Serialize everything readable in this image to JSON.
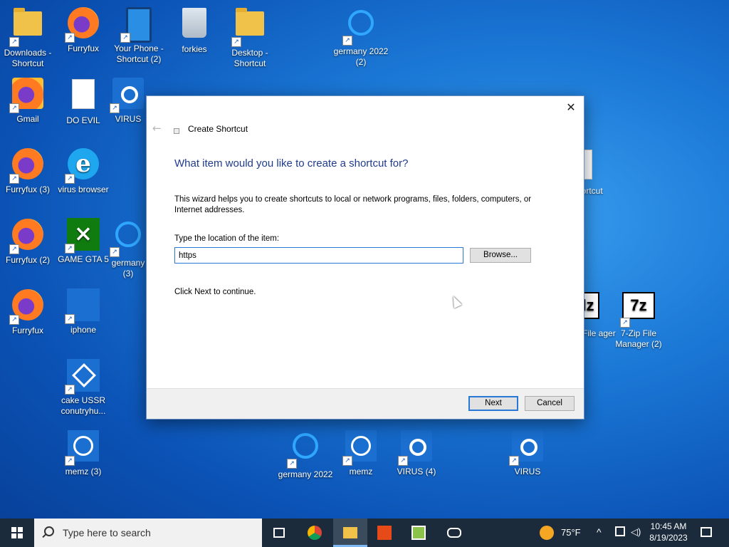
{
  "desktop": {
    "icons": [
      {
        "label": "Downloads - Shortcut",
        "icon": "folder-icon"
      },
      {
        "label": "Furryfux",
        "icon": "firefox-icon"
      },
      {
        "label": "Your Phone - Shortcut (2)",
        "icon": "phone-icon"
      },
      {
        "label": "forkies",
        "icon": "recycle-bin-icon"
      },
      {
        "label": "Desktop - Shortcut",
        "icon": "folder-icon"
      },
      {
        "label": "germany 2022 (2)",
        "icon": "cortana-ring-icon"
      },
      {
        "label": "Gmail",
        "icon": "firefox-icon"
      },
      {
        "label": "DO EVIL",
        "icon": "document-icon"
      },
      {
        "label": "VIRUS",
        "icon": "camera-icon"
      },
      {
        "label": "Furryfux (3)",
        "icon": "firefox-icon"
      },
      {
        "label": "virus browser",
        "icon": "internet-explorer-icon"
      },
      {
        "label": "Furryfux (2)",
        "icon": "firefox-icon"
      },
      {
        "label": "GAME GTA 5",
        "icon": "xbox-icon"
      },
      {
        "label": "germany (3)",
        "icon": "cortana-ring-icon"
      },
      {
        "label": "Furryfux",
        "icon": "firefox-icon"
      },
      {
        "label": "iphone",
        "icon": "tile-icon"
      },
      {
        "label": "cake USSR conutryhu...",
        "icon": "cube-icon"
      },
      {
        "label": "memz (3)",
        "icon": "alarm-clock-icon"
      },
      {
        "label": "germany 2022",
        "icon": "cortana-ring-icon"
      },
      {
        "label": "memz",
        "icon": "alarm-clock-icon"
      },
      {
        "label": "VIRUS (4)",
        "icon": "camera-icon"
      },
      {
        "label": "VIRUS",
        "icon": "camera-icon"
      },
      {
        "label": "hortcut",
        "icon": "document-icon"
      },
      {
        "label": "File ager",
        "icon": "7zip-icon"
      },
      {
        "label": "7-Zip File Manager (2)",
        "icon": "7zip-icon"
      }
    ]
  },
  "dialog": {
    "title": "Create Shortcut",
    "heading": "What item would you like to create a shortcut for?",
    "description": "This wizard helps you to create shortcuts to local or network programs, files, folders, computers, or Internet addresses.",
    "location_label": "Type the location of the item:",
    "location_value": "https",
    "browse_label": "Browse...",
    "continue_text": "Click Next to continue.",
    "next_label": "Next",
    "cancel_label": "Cancel",
    "close_glyph": "✕",
    "back_glyph": "←"
  },
  "taskbar": {
    "search_placeholder": "Type here to search",
    "weather": "75°F",
    "time": "10:45 AM",
    "date": "8/19/2023",
    "apps": [
      "task-view-icon",
      "chrome-icon",
      "file-explorer-icon",
      "office-icon",
      "notepad-icon",
      "vr-headset-icon"
    ]
  },
  "colors": {
    "accent": "#2a78d6",
    "heading": "#1f3b8c",
    "taskbar": "#1b2b3c"
  }
}
